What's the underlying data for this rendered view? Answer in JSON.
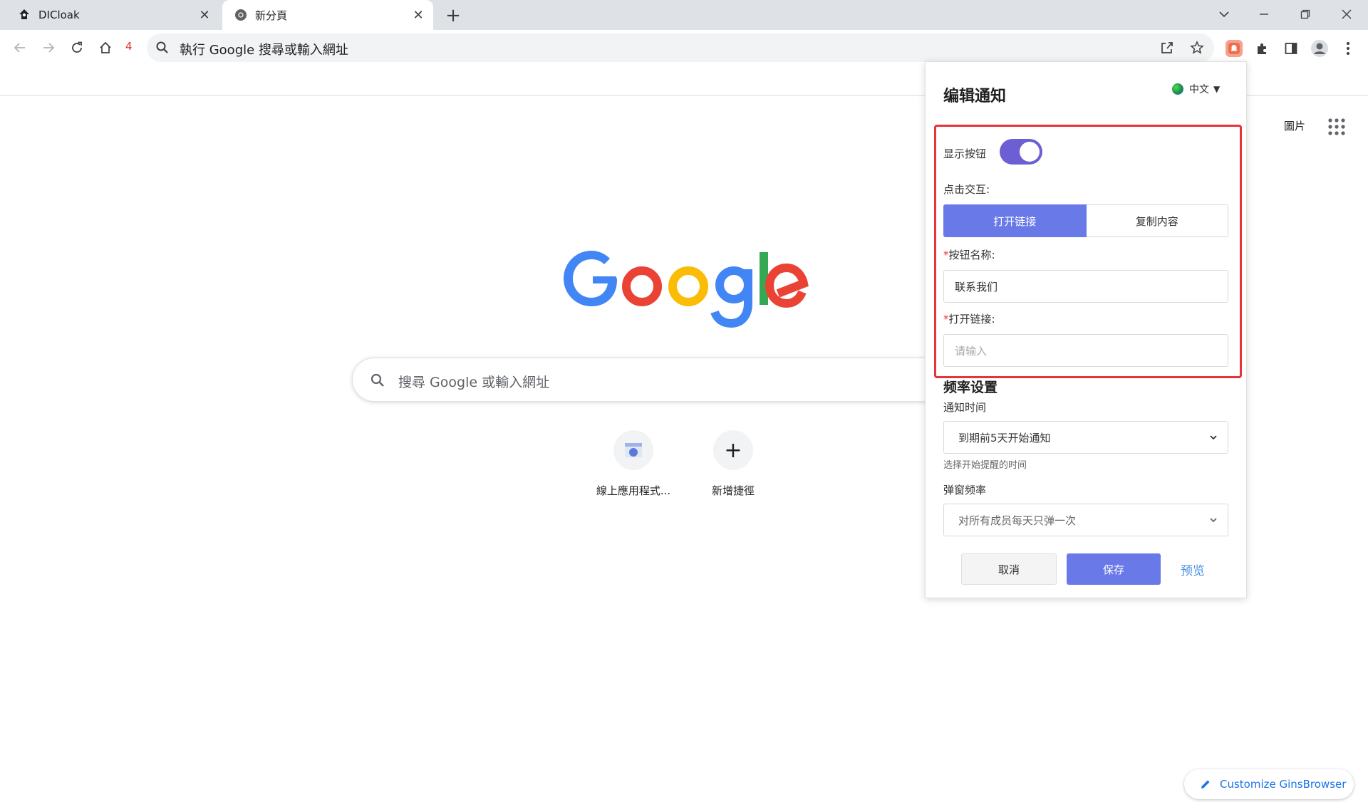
{
  "tabs": [
    {
      "title": "DICloak",
      "active": false
    },
    {
      "title": "新分頁",
      "active": true
    }
  ],
  "toolbar": {
    "extension_badge": "4",
    "omnibox_text": "執行 Google 搜尋或輸入網址"
  },
  "ntp": {
    "images_link": "圖片",
    "search_placeholder": "搜尋 Google 或輸入網址",
    "shortcuts": [
      {
        "label": "線上應用程式...",
        "icon": "web-app-icon"
      },
      {
        "label": "新增捷徑",
        "icon": "plus-icon"
      }
    ],
    "customize_label": "Customize GinsBrowser"
  },
  "popup": {
    "title": "编辑通知",
    "language": "中文",
    "show_button_label": "显示按钮",
    "show_button_on": true,
    "click_action_label": "点击交互:",
    "click_options": [
      "打开链接",
      "复制内容"
    ],
    "click_selected": "打开链接",
    "button_name_label": "按钮名称:",
    "button_name_value": "联系我们",
    "open_link_label": "打开链接:",
    "open_link_placeholder": "请输入",
    "frequency_title": "频率设置",
    "notify_time_label": "通知时间",
    "notify_time_value": "到期前5天开始通知",
    "notify_time_hint": "选择开始提醒的时间",
    "popup_freq_label": "弹窗频率",
    "popup_freq_value": "对所有成员每天只弹一次",
    "cancel_label": "取消",
    "save_label": "保存",
    "preview_label": "预览",
    "accent_color": "#6979e8",
    "highlight_color": "#e8333a"
  }
}
